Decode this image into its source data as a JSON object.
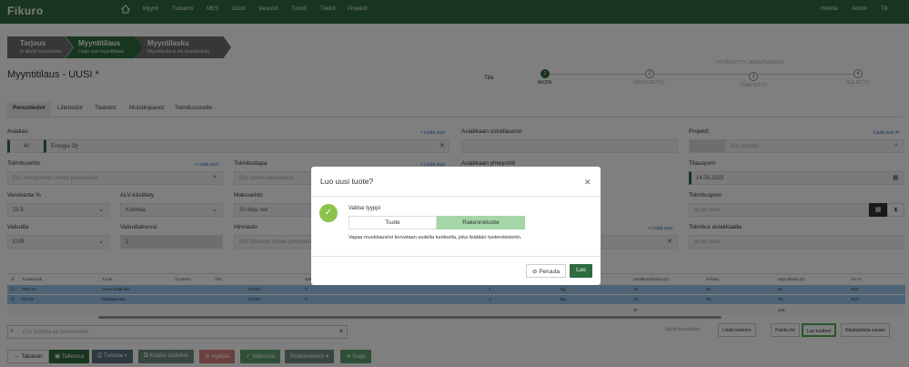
{
  "app": {
    "logo": "Fikuro",
    "nav": [
      "Myynti",
      "Tuotanto",
      "MES",
      "Ostot",
      "Varastot",
      "Tunnit",
      "Tiedot",
      "Projektit"
    ],
    "right": [
      "Helinta",
      "Admin",
      "Tili"
    ]
  },
  "breadcrumb": [
    {
      "title": "Tarjous",
      "sub": "Ei liitetty tarjoukseen"
    },
    {
      "title": "Myyntitilaus",
      "sub": "Lisää uusi myyntitilaus"
    },
    {
      "title": "Myyntilasku",
      "sub": "Myyntilasku ei ole muodostettu"
    }
  ],
  "page_title": "Myyntitilaus - UUSI *",
  "status": {
    "label": "Tila",
    "steps": [
      "AVOIN",
      "VAHVISTETTU",
      "TOIMITETTU",
      "SULJETTU"
    ],
    "extra": "HYVÄKSYTTY LASKUTUKSEEN",
    "nums": [
      "1",
      "2",
      "3",
      "4"
    ]
  },
  "tabs": [
    "Perustiedot",
    "Liitetiedot",
    "Tiedotot",
    "Muistiinpanot",
    "Toimitusosoite"
  ],
  "form": {
    "asiakas_label": "Asiakas",
    "asiakas_no": "40",
    "asiakas_name": "Energia Oy",
    "add_new": "+ Lisää uusi",
    "ostotilaus_label": "Asiakkaan ostotilausno",
    "projekti_label": "Projekti",
    "projekti_add": "Lisää uusi ⇄",
    "projekti_ph": "Etsi projekti",
    "toimitusehto_label": "Toimitusehto",
    "toimitusehto_ph": "Etsi toimitusehto nimen perusteella",
    "toimitustapa_label": "Toimitustapa",
    "toimitustapa_ph": "Etsi nimen perusteella",
    "yhteys_label": "Asiakkaan yhteyshlö",
    "tilauspvm_label": "Tilauspvm",
    "tilauspvm": "14.05.2025",
    "verokanta_label": "Verokanta %",
    "verokanta": "25.5",
    "alv_label": "ALV-käsittely",
    "alv": "Kotimaa",
    "maksuehto_label": "Maksuehto",
    "maksuehto": "30 days net",
    "toimituspvm_label": "Toimituspvm",
    "toimituspvm_ph": "pp.kk.vvvv",
    "valuutta_label": "Valuutta",
    "valuutta": "EUR",
    "kurssi_label": "Valuuttakurssi",
    "kurssi": "1",
    "hinnasto_label": "Hinnasto",
    "hinnasto_ph": "Etsi hinnasto nimen perusteella",
    "toimitus_asiakkaalla_label": "Toimitus asiakkaalla",
    "toimitus_asiakkaalla_ph": "pp.kk.vvvv"
  },
  "grid": {
    "headers": [
      "Tuotekoodi",
      "Tuote",
      "Tuotenro",
      "Tila",
      "Saldo",
      "",
      "",
      "",
      "",
      "Sisäänostohinta (€)",
      "a-hinta",
      "Myyntihinta (€)",
      "Alv %"
    ],
    "rows": [
      {
        "code": "TRV-14",
        "name": "Asennustarvike",
        "status": "AVOIN",
        "y": "Y",
        "n": "1",
        "unit": "Kg",
        "p1": "24",
        "p2": "66",
        "p3": "66",
        "vat": "25,5"
      },
      {
        "code": "PH-33",
        "name": "Palkkatuntas",
        "status": "AVOIN",
        "y": "Y",
        "n": "1",
        "unit": "kpl",
        "p1": "23",
        "p2": "76",
        "p3": "76",
        "vat": "25,5"
      }
    ],
    "totals": [
      "47",
      "144"
    ]
  },
  "search_ph": "Etsi tuotetta tai tuotekoodia",
  "side_buttons": [
    "Näytä transaktiot",
    "Lisää tuotenro",
    "Poista rivi",
    "Luo tuotteet",
    "Näytä/piilota sarake"
  ],
  "bottom": [
    "Takaisin",
    "Tallenna",
    "Tulosta",
    "Kopioi uudeksi",
    "Hylkää",
    "Vahvista",
    "Rivitoiminnot",
    "Sulje"
  ],
  "modal": {
    "title": "Luo uusi tuote?",
    "choose": "Valitse tyyppi",
    "opt1": "Tuote",
    "opt2": "Rakennetuote",
    "info": "Vapaa muokkausrivi korvataan uudella tuotteella, joka lisätään tuoterekisteriin.",
    "cancel": "Peruuta",
    "create": "Luo"
  },
  "colors": {
    "brand": "#2e6b3f",
    "accent": "#2b6dbf",
    "row_sel": "#9cc7ec",
    "toggle_on": "#a5d6a7"
  }
}
